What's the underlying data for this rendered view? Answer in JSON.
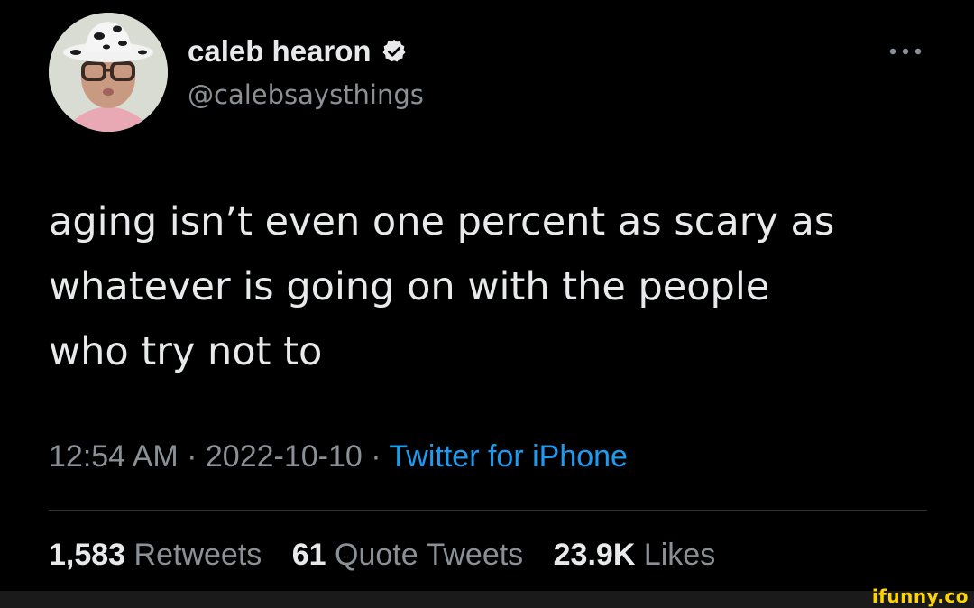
{
  "author": {
    "display_name": "caleb hearon",
    "handle": "@calebsaysthings",
    "avatar_icon": "user-avatar-cowboy-hat",
    "verified_icon": "verified-badge-icon"
  },
  "more_icon": "more-options-icon",
  "tweet": {
    "lines": [
      "aging isn’t even one percent as scary as",
      "whatever is going on with the people",
      "who try not to"
    ],
    "time": "12:54 AM",
    "separator": " · ",
    "date": "2022-10-10",
    "source": "Twitter for iPhone"
  },
  "stats": {
    "retweets_count": "1,583",
    "retweets_label": "Retweets",
    "quotes_count": "61",
    "quotes_label": "Quote Tweets",
    "likes_count": "23.9K",
    "likes_label": "Likes"
  },
  "watermark": "ifunny.co",
  "colors": {
    "background": "#000000",
    "primary_text": "#e7e9ea",
    "secondary_text": "#8b9096",
    "link": "#1d9bf0",
    "divider": "#2f3336",
    "watermark": "#ffd400"
  }
}
